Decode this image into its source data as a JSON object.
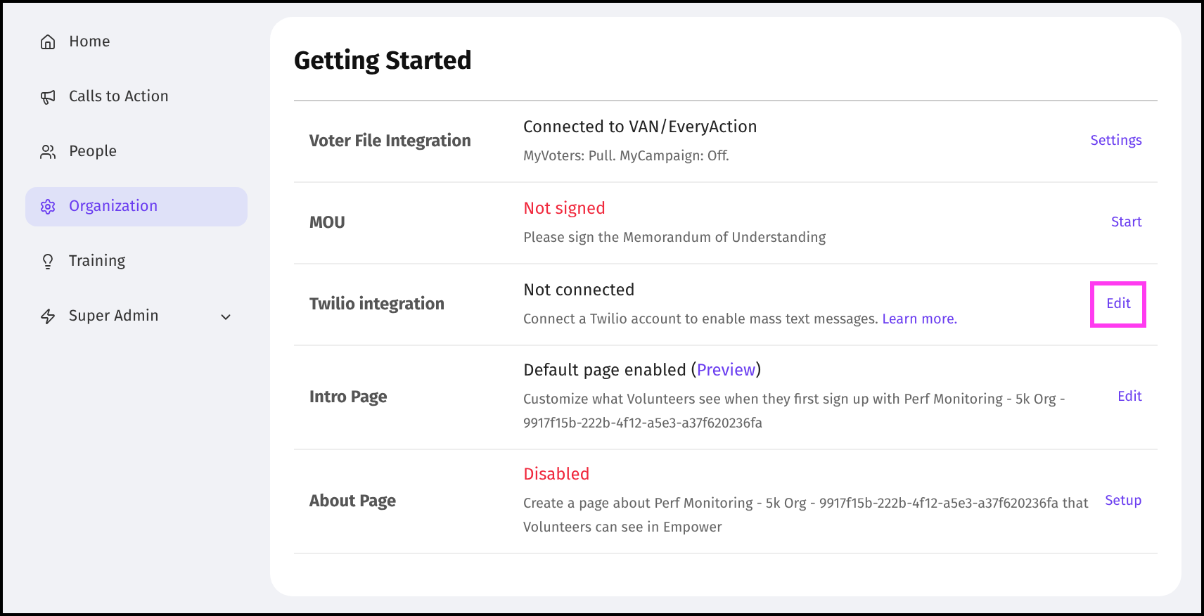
{
  "sidebar": {
    "items": [
      {
        "label": "Home",
        "selected": false,
        "expandable": false
      },
      {
        "label": "Calls to Action",
        "selected": false,
        "expandable": false
      },
      {
        "label": "People",
        "selected": false,
        "expandable": false
      },
      {
        "label": "Organization",
        "selected": true,
        "expandable": false
      },
      {
        "label": "Training",
        "selected": false,
        "expandable": false
      },
      {
        "label": "Super Admin",
        "selected": false,
        "expandable": true
      }
    ]
  },
  "page": {
    "title": "Getting Started",
    "rows": [
      {
        "name": "Voter File Integration",
        "status": "Connected to VAN/EveryAction",
        "alert": false,
        "description": "MyVoters: Pull. MyCampaign: Off.",
        "action": "Settings",
        "highlighted": false
      },
      {
        "name": "MOU",
        "status": "Not signed",
        "alert": true,
        "description": "Please sign the Memorandum of Understanding",
        "action": "Start",
        "highlighted": false
      },
      {
        "name": "Twilio integration",
        "status": "Not connected",
        "alert": false,
        "description": "Connect a Twilio account to enable mass text messages.",
        "description_link": "Learn more.",
        "action": "Edit",
        "highlighted": true
      },
      {
        "name": "Intro Page",
        "status": "Default page enabled (",
        "status_link": "Preview",
        "status_after": ")",
        "alert": false,
        "description": "Customize what Volunteers see when they first sign up with Perf Monitoring - 5k Org - 9917f15b-222b-4f12-a5e3-a37f620236fa",
        "action": "Edit",
        "highlighted": false
      },
      {
        "name": "About Page",
        "status": "Disabled",
        "alert": true,
        "description": "Create a page about Perf Monitoring - 5k Org - 9917f15b-222b-4f12-a5e3-a37f620236fa that Volunteers can see in Empower",
        "action": "Setup",
        "highlighted": false
      }
    ]
  }
}
